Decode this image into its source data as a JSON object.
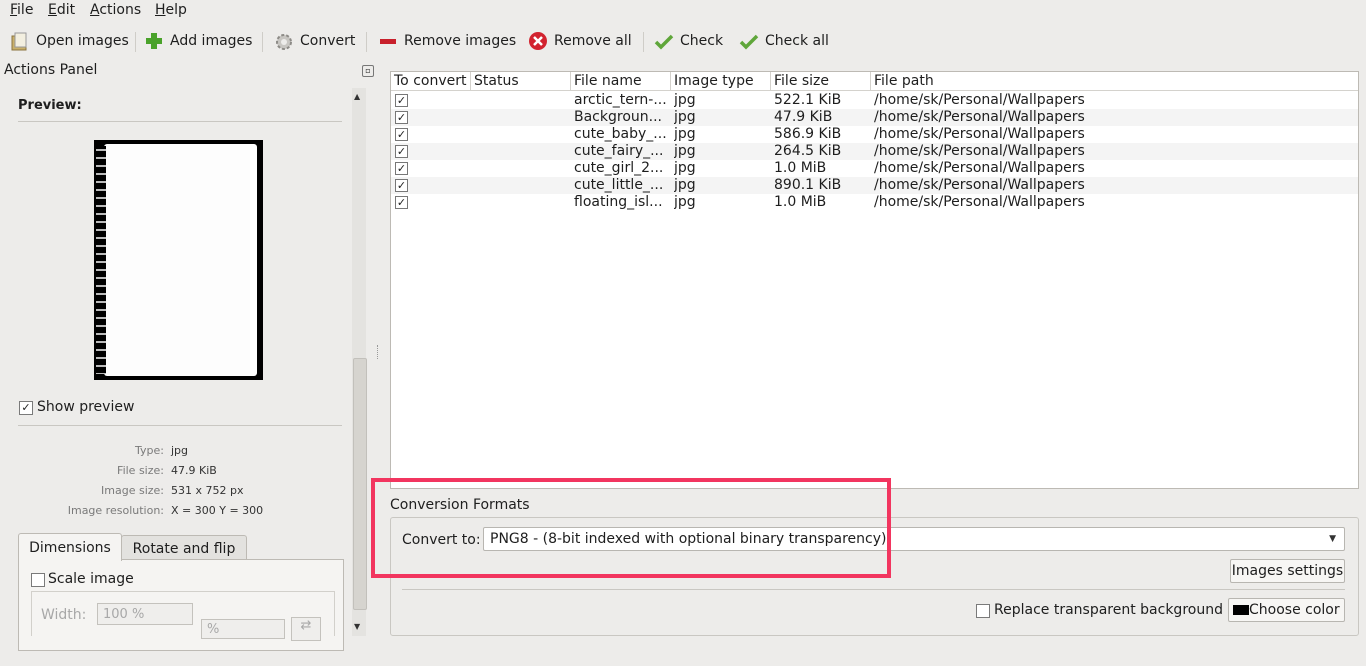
{
  "menu": {
    "file": "File",
    "edit": "Edit",
    "actions": "Actions",
    "help": "Help"
  },
  "toolbar": {
    "open_images": "Open images",
    "add_images": "Add images",
    "convert": "Convert",
    "remove_images": "Remove images",
    "remove_all": "Remove all",
    "check": "Check",
    "check_all": "Check all"
  },
  "actions_panel": {
    "title": "Actions Panel",
    "preview_label": "Preview:",
    "show_preview": "Show preview",
    "info": [
      {
        "label": "Type:",
        "value": "jpg"
      },
      {
        "label": "File size:",
        "value": "47.9 KiB"
      },
      {
        "label": "Image size:",
        "value": "531 x 752 px"
      },
      {
        "label": "Image resolution:",
        "value": "X = 300 Y = 300"
      }
    ],
    "tabs": {
      "dimensions": "Dimensions",
      "rotate_flip": "Rotate and flip"
    },
    "scale_image": "Scale image",
    "width_label": "Width:",
    "width_value": "100 %",
    "unit_value": "%"
  },
  "table": {
    "headers": {
      "to_convert": "To convert",
      "status": "Status",
      "file_name": "File name",
      "image_type": "Image type",
      "file_size": "File size",
      "file_path": "File path"
    },
    "rows": [
      {
        "name": "arctic_tern-...",
        "type": "jpg",
        "size": "522.1 KiB",
        "path": "/home/sk/Personal/Wallpapers"
      },
      {
        "name": "Backgroun...",
        "type": "jpg",
        "size": "47.9 KiB",
        "path": "/home/sk/Personal/Wallpapers"
      },
      {
        "name": "cute_baby_...",
        "type": "jpg",
        "size": "586.9 KiB",
        "path": "/home/sk/Personal/Wallpapers"
      },
      {
        "name": "cute_fairy_...",
        "type": "jpg",
        "size": "264.5 KiB",
        "path": "/home/sk/Personal/Wallpapers"
      },
      {
        "name": "cute_girl_2...",
        "type": "jpg",
        "size": "1.0 MiB",
        "path": "/home/sk/Personal/Wallpapers"
      },
      {
        "name": "cute_little_...",
        "type": "jpg",
        "size": "890.1 KiB",
        "path": "/home/sk/Personal/Wallpapers"
      },
      {
        "name": "floating_isl...",
        "type": "jpg",
        "size": "1.0 MiB",
        "path": "/home/sk/Personal/Wallpapers"
      }
    ]
  },
  "conversion": {
    "title": "Conversion Formats",
    "convert_to_label": "Convert to:",
    "selected_format": "PNG8 - (8-bit indexed with optional binary transparency)",
    "images_settings": "Images settings",
    "replace_bg": "Replace transparent background",
    "choose_color": "Choose color"
  },
  "colors": {
    "highlight": "#f2355f"
  }
}
